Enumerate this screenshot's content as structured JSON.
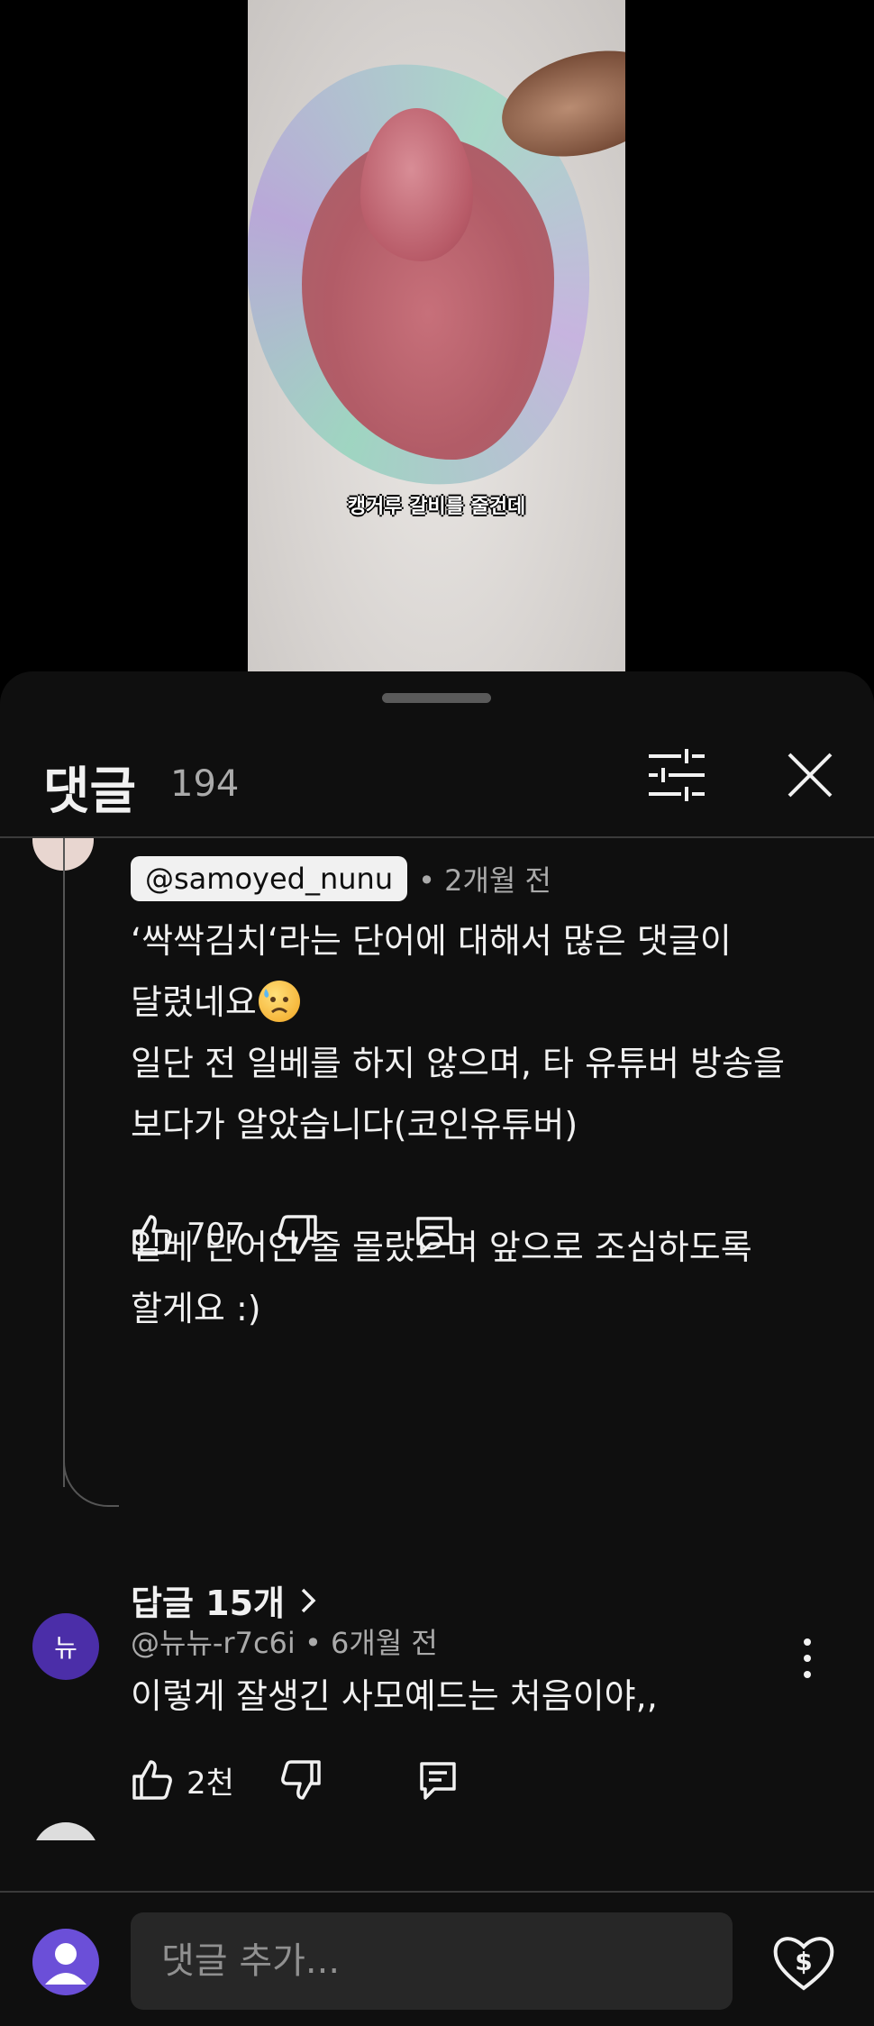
{
  "video": {
    "caption": "캥거루 갈비를 줄건데"
  },
  "panel": {
    "title": "댓글",
    "count": "194"
  },
  "pinned_comment": {
    "author": "@samoyed_nunu",
    "age": "• 2개월 전",
    "line1": "‘싹싹김치‘라는 단어에 대해서 많은 댓글이",
    "line2": "달렸네요",
    "rest": "일단 전 일베를 하지 않으며, 타 유튜버 방송을\n보다가 알았습니다(코인유튜버)\n\n일베 단어인 줄 몰랐으며 앞으로 조심하도록\n할게요 :)",
    "likes": "707",
    "replies": "답글 15개"
  },
  "comment2": {
    "avatar_letter": "뉴",
    "author": "@뉴뉴-r7c6i",
    "age": "• 6개월 전",
    "text": "이렇게 잘생긴 사모예드는 처음이야,,",
    "likes": "2천"
  },
  "composer": {
    "placeholder": "댓글 추가..."
  },
  "icons": {
    "filter": "sliders-icon",
    "close": "close-icon",
    "like": "thumb-up-icon",
    "dislike": "thumb-down-icon",
    "reply": "reply-icon",
    "more": "more-vert-icon",
    "thanks": "heart-dollar-icon",
    "emoji": "sad-sweat-emoji-icon"
  },
  "colors": {
    "background": "#0f0f0f",
    "text": "#f1f1f1",
    "secondary": "#aaaaaa",
    "avatar_purple": "#4b2ea8"
  }
}
